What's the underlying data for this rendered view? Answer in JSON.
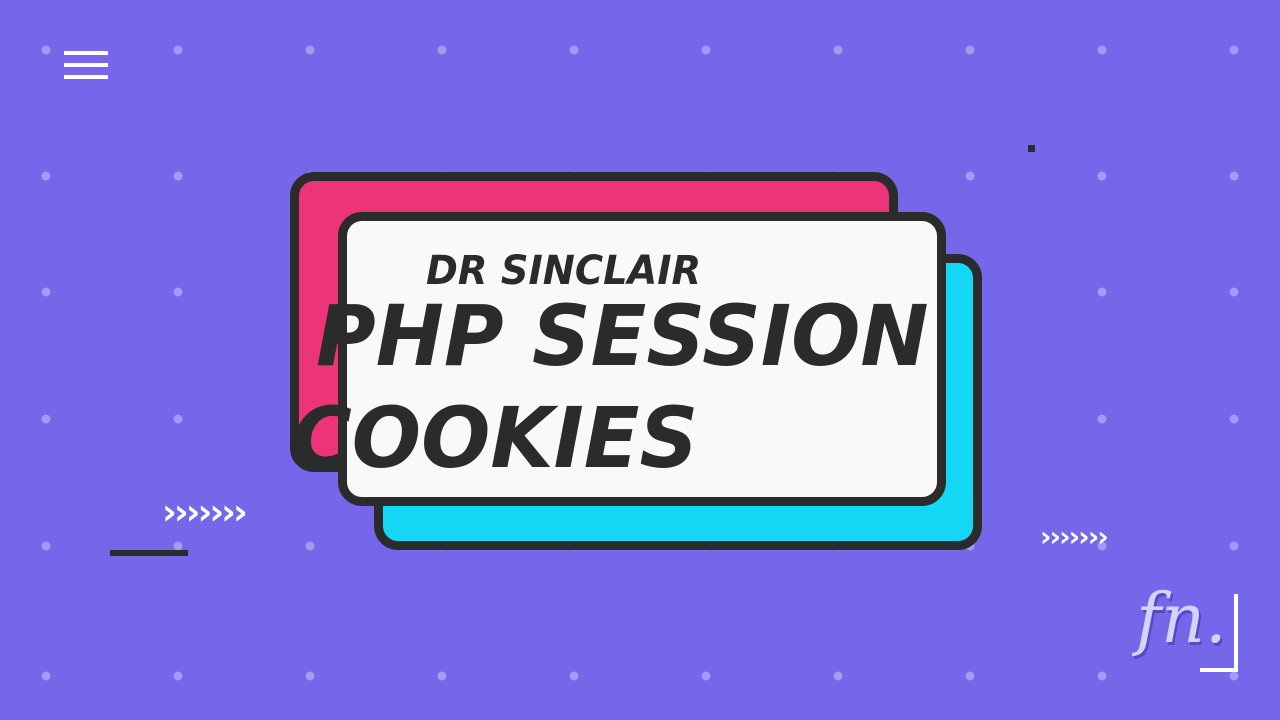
{
  "slide": {
    "subtitle": "DR SINCLAIR",
    "title_line_1": "PHP SESSION",
    "title_line_2": "COOKIES"
  },
  "decor": {
    "chevrons_left": "›››››››",
    "chevrons_right": "›››››››",
    "logo_text": "fn."
  },
  "colors": {
    "background": "#7566ea",
    "card_pink": "#ec3479",
    "card_cyan": "#13d7f5",
    "card_white": "#f9f9f9",
    "outline": "#2b2b2b"
  },
  "icons": {
    "menu": "hamburger-menu-icon"
  }
}
